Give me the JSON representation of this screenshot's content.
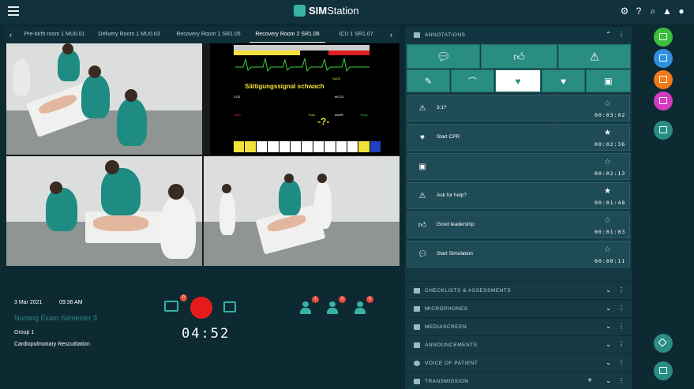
{
  "app": {
    "name_prefix": "SIM",
    "name_suffix": "Station"
  },
  "topbar_icons": [
    "gear-icon",
    "help-icon",
    "search-icon",
    "bell-icon",
    "user-icon"
  ],
  "tabs": {
    "items": [
      "Pre-birth room 1 MU0.01",
      "Delivery Room 1 MU0.03",
      "Recovery Room 1 SR1.05",
      "Recovery Room 2 SR1.06",
      "ICU 1 SR1.07"
    ],
    "active_index": 3
  },
  "monitor": {
    "message": "Sättigungssignal schwach",
    "labels": [
      "SpO2",
      "CO2",
      "etCO2",
      "NIBD",
      "Puls",
      "awRR",
      "Temp",
      "-?-"
    ]
  },
  "session": {
    "date": "3 Mar 2021",
    "time": "09:36 AM",
    "exam": "Nursing Exam Semester 3",
    "group": "Group 1",
    "topic": "Cardiopulmonary Rescutitation",
    "timer": "04:52",
    "cast_badge": "0",
    "role_badges": [
      "1",
      "5",
      "6"
    ]
  },
  "annotations": {
    "header": "ANNOTATIONS",
    "rows": [
      {
        "icon": "warning-icon",
        "label": "3:1?",
        "starred": false,
        "time": "00:03:02"
      },
      {
        "icon": "heart-hand-icon",
        "label": "Start CPR",
        "starred": true,
        "time": "00:02:36"
      },
      {
        "icon": "monitor-icon",
        "label": "",
        "starred": false,
        "time": "00:02:13"
      },
      {
        "icon": "warning-icon",
        "label": "Ask for help?",
        "starred": true,
        "time": "00:01:48"
      },
      {
        "icon": "thumbs-up-icon",
        "label": "Good leadership",
        "starred": false,
        "time": "00:01:03"
      },
      {
        "icon": "chat-icon",
        "label": "Start Simulation",
        "starred": false,
        "time": "00:00:11"
      }
    ]
  },
  "sections": [
    "CHECKLISTS & ASSESSMENTS",
    "MICROPHONES",
    "MEDIASCREEN",
    "ANNOUNCEMENTS",
    "VOICE OF PATIENT",
    "TRANSMISSION"
  ],
  "colors": {
    "accent": "#2a8d82",
    "record": "#e81b1b",
    "side_green": "#3bbf3b",
    "side_blue": "#2f8fe0",
    "side_orange": "#f07a1a",
    "side_pink": "#d43cc0",
    "side_teal": "#2a8d82"
  }
}
